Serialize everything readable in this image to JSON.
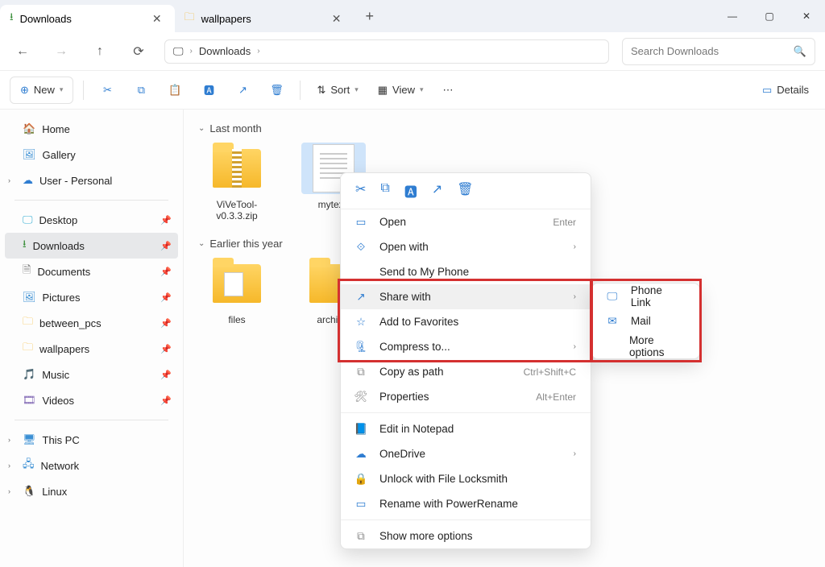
{
  "tabs": [
    {
      "label": "Downloads",
      "active": true
    },
    {
      "label": "wallpapers",
      "active": false
    }
  ],
  "breadcrumb": {
    "current": "Downloads"
  },
  "search": {
    "placeholder": "Search Downloads"
  },
  "toolbar": {
    "new_label": "New",
    "sort_label": "Sort",
    "view_label": "View",
    "details_label": "Details"
  },
  "sidebar": {
    "top": [
      {
        "label": "Home",
        "icon": "home"
      },
      {
        "label": "Gallery",
        "icon": "gallery"
      },
      {
        "label": "User - Personal",
        "icon": "onedrive",
        "expandable": true
      }
    ],
    "quick": [
      {
        "label": "Desktop",
        "icon": "desktop"
      },
      {
        "label": "Downloads",
        "icon": "downloads",
        "active": true
      },
      {
        "label": "Documents",
        "icon": "documents"
      },
      {
        "label": "Pictures",
        "icon": "pictures"
      },
      {
        "label": "between_pcs",
        "icon": "folder"
      },
      {
        "label": "wallpapers",
        "icon": "folder"
      },
      {
        "label": "Music",
        "icon": "music"
      },
      {
        "label": "Videos",
        "icon": "videos"
      }
    ],
    "drives": [
      {
        "label": "This PC",
        "icon": "pc"
      },
      {
        "label": "Network",
        "icon": "network"
      },
      {
        "label": "Linux",
        "icon": "linux"
      }
    ]
  },
  "groups": [
    {
      "header": "Last month",
      "items": [
        {
          "name": "ViVeTool-v0.3.3.zip",
          "type": "zip"
        },
        {
          "name": "mytext.",
          "type": "file",
          "selected": true
        }
      ]
    },
    {
      "header": "Earlier this year",
      "items": [
        {
          "name": "files",
          "type": "folder-open"
        },
        {
          "name": "archival",
          "type": "folder"
        }
      ]
    }
  ],
  "context_menu": {
    "items": [
      {
        "label": "Open",
        "hint": "Enter",
        "icon": "open"
      },
      {
        "label": "Open with",
        "icon": "openwith",
        "submenu": true
      },
      {
        "label": "Send to My Phone",
        "icon": ""
      },
      {
        "label": "Share with",
        "icon": "share",
        "submenu": true,
        "highlighted": true
      },
      {
        "label": "Add to Favorites",
        "icon": "star"
      },
      {
        "label": "Compress to...",
        "icon": "compress",
        "submenu": true
      },
      {
        "label": "Copy as path",
        "hint": "Ctrl+Shift+C",
        "icon": "copypath"
      },
      {
        "label": "Properties",
        "hint": "Alt+Enter",
        "icon": "properties"
      },
      {
        "sep": true
      },
      {
        "label": "Edit in Notepad",
        "icon": "notepad"
      },
      {
        "label": "OneDrive",
        "icon": "onedrive",
        "submenu": true
      },
      {
        "label": "Unlock with File Locksmith",
        "icon": "lock"
      },
      {
        "label": "Rename with PowerRename",
        "icon": "rename"
      },
      {
        "sep": true
      },
      {
        "label": "Show more options",
        "icon": "more"
      }
    ]
  },
  "share_submenu": {
    "items": [
      {
        "label": "Phone Link",
        "icon": "phone"
      },
      {
        "label": "Mail",
        "icon": "mail"
      },
      {
        "label": "More options",
        "icon": ""
      }
    ]
  }
}
